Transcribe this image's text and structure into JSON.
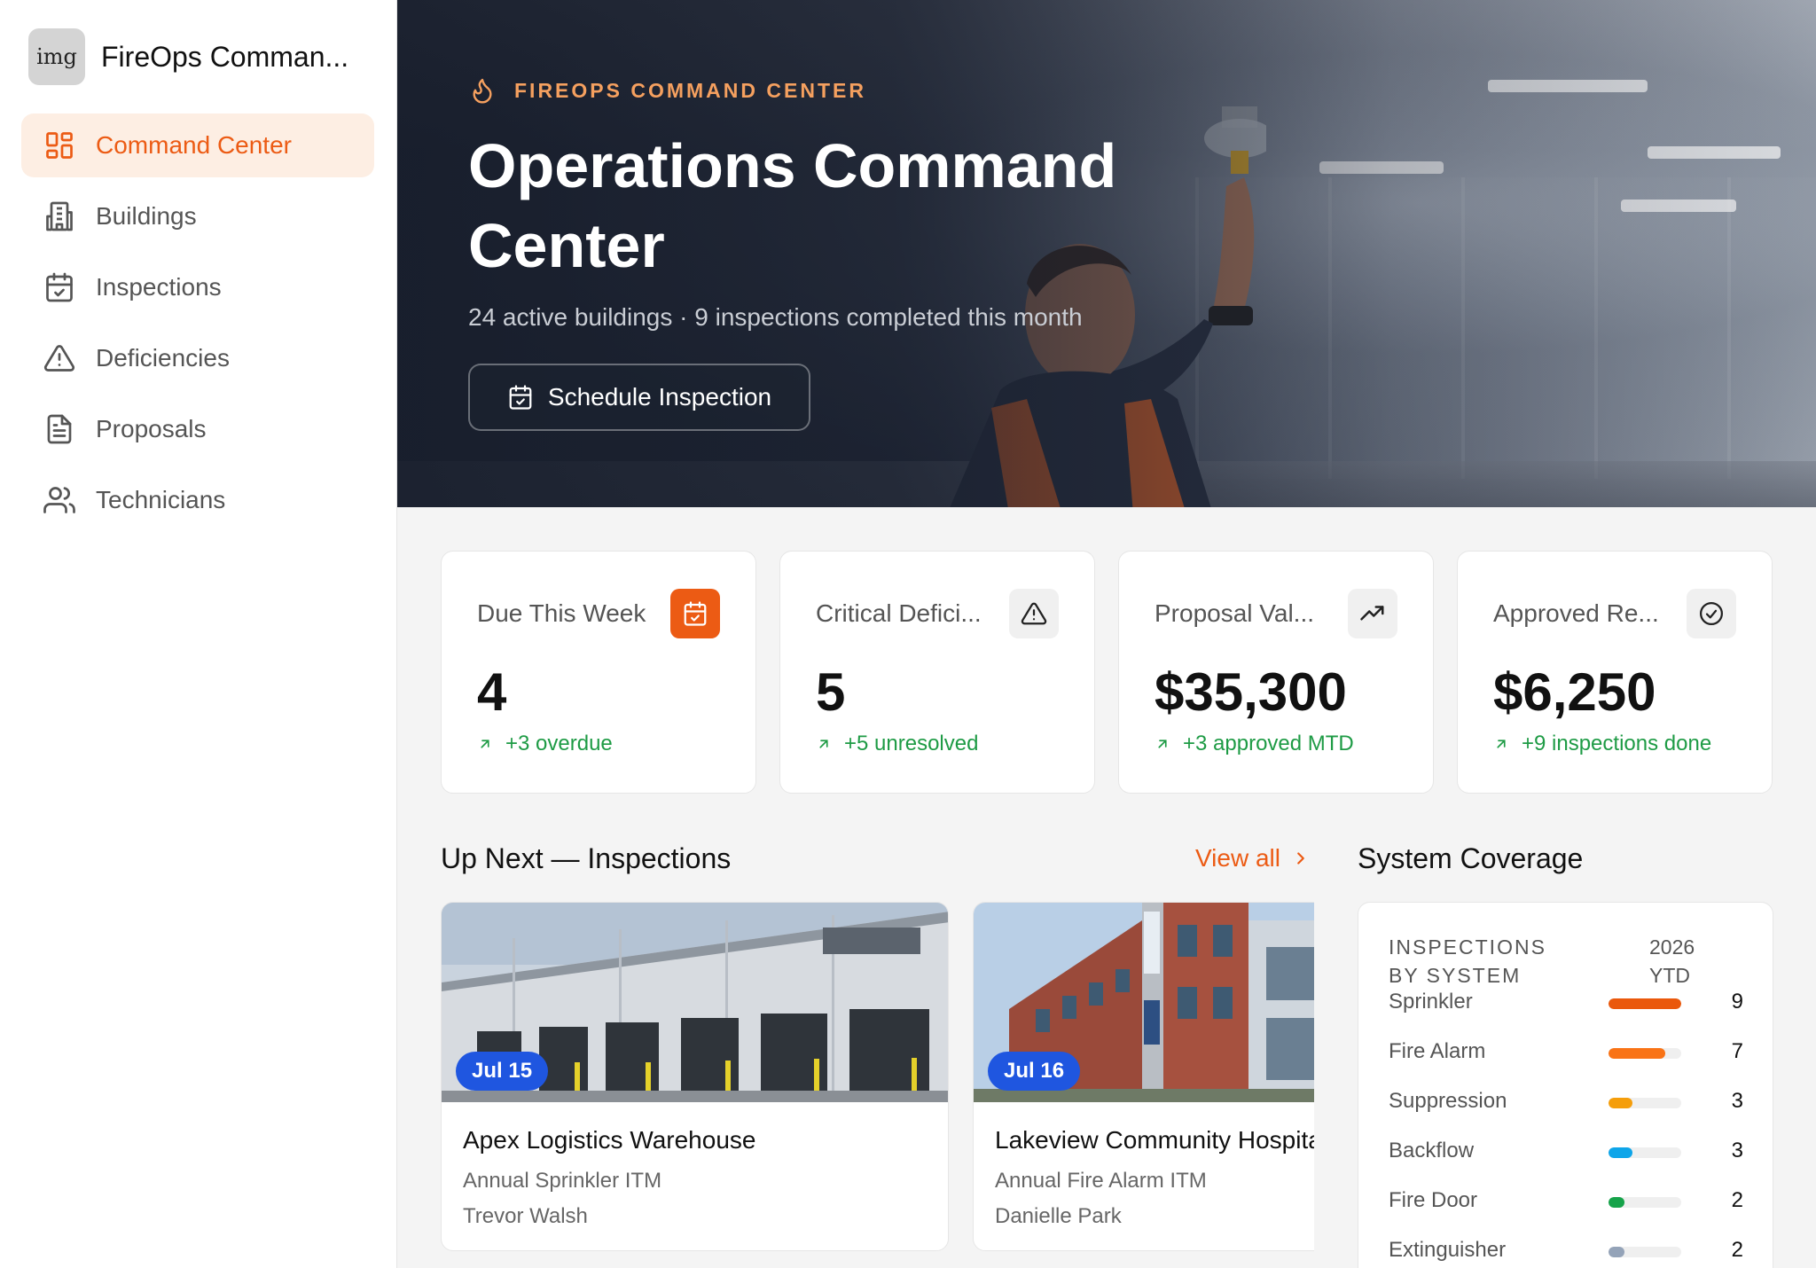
{
  "app": {
    "name": "FireOps Comman...",
    "logo_text": "img"
  },
  "sidebar": {
    "items": [
      {
        "label": "Command Center",
        "icon": "dashboard-icon",
        "active": true
      },
      {
        "label": "Buildings",
        "icon": "building-icon"
      },
      {
        "label": "Inspections",
        "icon": "calendar-check-icon"
      },
      {
        "label": "Deficiencies",
        "icon": "warning-icon"
      },
      {
        "label": "Proposals",
        "icon": "document-icon"
      },
      {
        "label": "Technicians",
        "icon": "users-icon"
      }
    ]
  },
  "hero": {
    "eyebrow": "FIREOPS COMMAND CENTER",
    "title": "Operations Command Center",
    "subtitle": "24 active buildings · 9 inspections completed this month",
    "button_label": "Schedule Inspection"
  },
  "stats": [
    {
      "label": "Due This Week",
      "value": "4",
      "trend": "+3 overdue",
      "icon": "calendar-icon"
    },
    {
      "label": "Critical Defici...",
      "value": "5",
      "trend": "+5 unresolved",
      "icon": "warning-icon"
    },
    {
      "label": "Proposal Val...",
      "value": "$35,300",
      "trend": "+3 approved MTD",
      "icon": "trending-up-icon"
    },
    {
      "label": "Approved Re...",
      "value": "$6,250",
      "trend": "+9 inspections done",
      "icon": "check-circle-icon"
    }
  ],
  "up_next": {
    "title": "Up Next — Inspections",
    "view_all": "View all",
    "cards": [
      {
        "date": "Jul 15",
        "name": "Apex Logistics Warehouse",
        "type": "Annual Sprinkler ITM",
        "tech": "Trevor Walsh"
      },
      {
        "date": "Jul 16",
        "name": "Lakeview Community Hospital",
        "type": "Annual Fire Alarm ITM",
        "tech": "Danielle Park"
      }
    ]
  },
  "coverage": {
    "title": "System Coverage",
    "heading": "INSPECTIONS BY SYSTEM",
    "period": "2026 YTD",
    "max": 9,
    "rows": [
      {
        "name": "Sprinkler",
        "count": 9,
        "color": "#ea580c"
      },
      {
        "name": "Fire Alarm",
        "count": 7,
        "color": "#f97316"
      },
      {
        "name": "Suppression",
        "count": 3,
        "color": "#f59e0b"
      },
      {
        "name": "Backflow",
        "count": 3,
        "color": "#0ea5e9"
      },
      {
        "name": "Fire Door",
        "count": 2,
        "color": "#16a34a"
      },
      {
        "name": "Extinguisher",
        "count": 2,
        "color": "#94a3b8"
      }
    ]
  },
  "colors": {
    "accent": "#ec5b14",
    "positive": "#1e9b45",
    "badge": "#1f56e0"
  }
}
